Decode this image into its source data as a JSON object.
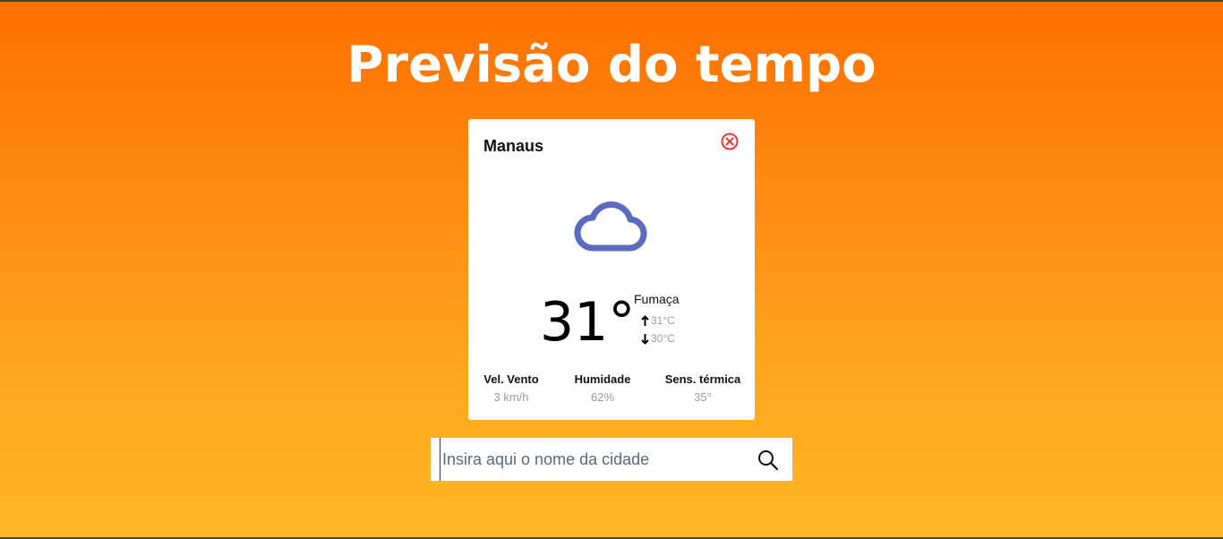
{
  "title": "Previsão do tempo",
  "card": {
    "city": "Manaus",
    "close_icon": "close-circle-icon",
    "weather_icon": "cloud-icon",
    "temperature": "31°",
    "condition": "Fumaça",
    "max_temp": "31°C",
    "min_temp": "30°C",
    "stats": {
      "wind": {
        "label": "Vel. Vento",
        "value": "3 km/h"
      },
      "humidity": {
        "label": "Humidade",
        "value": "62%"
      },
      "feels_like": {
        "label": "Sens. térmica",
        "value": "35°"
      }
    }
  },
  "search": {
    "placeholder": "Insira aqui o nome da cidade",
    "value": "",
    "icon": "search-icon"
  },
  "colors": {
    "background_top": "#ff6f00",
    "background_bottom": "#ffb724",
    "cloud_icon": "#5c6bc0",
    "close_icon": "#e53935"
  }
}
